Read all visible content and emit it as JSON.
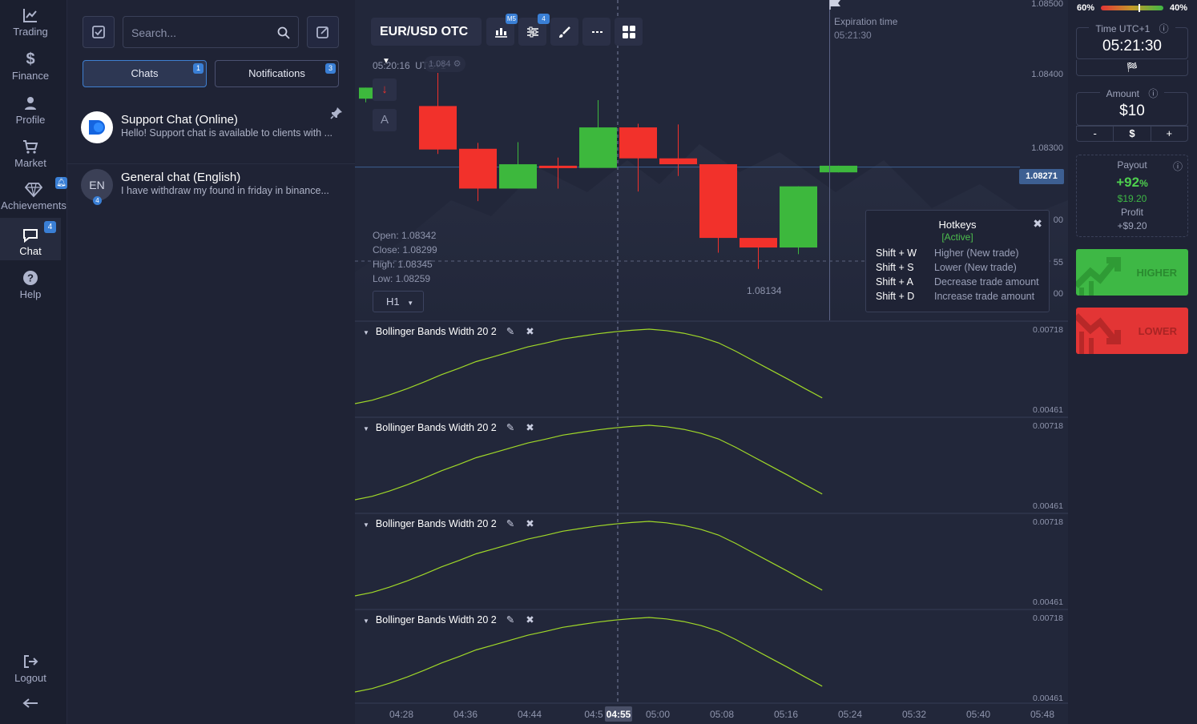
{
  "nav": {
    "items": [
      {
        "label": "Trading",
        "icon": "chart-line-icon"
      },
      {
        "label": "Finance",
        "icon": "dollar-icon"
      },
      {
        "label": "Profile",
        "icon": "user-icon"
      },
      {
        "label": "Market",
        "icon": "cart-icon"
      },
      {
        "label": "Achievements",
        "icon": "diamond-icon",
        "badge": "bell"
      },
      {
        "label": "Chat",
        "icon": "chat-icon",
        "badge": "4",
        "active": true
      },
      {
        "label": "Help",
        "icon": "help-icon"
      }
    ],
    "logout": "Logout",
    "collapse_icon": "arrow-left-icon"
  },
  "chat": {
    "search_placeholder": "Search...",
    "tabs": [
      {
        "label": "Chats",
        "badge": "1",
        "active": true
      },
      {
        "label": "Notifications",
        "badge": "3",
        "active": false
      }
    ],
    "items": [
      {
        "title": "Support Chat (Online)",
        "preview": "Hello! Support chat is available to clients with ...",
        "pinned": true,
        "avatar": "logo"
      },
      {
        "title": "General chat (English)",
        "preview": "I have withdraw my found in friday in binance...",
        "avatar_text": "EN",
        "avatar_badge": "4"
      }
    ]
  },
  "chart": {
    "pair": "EUR/USD OTC",
    "badges": {
      "chart_type": "M5",
      "indicators": "4"
    },
    "server_time": "05:20:16",
    "timezone": "UTC+1",
    "faded_price": "1.084",
    "trade_marker_down": "↓",
    "trade_marker_auto": "A",
    "expiration_label": "Expiration time",
    "expiration_time": "05:21:30",
    "ohlc": {
      "open": "Open: 1.08342",
      "close": "Close: 1.08299",
      "high": "High: 1.08345",
      "low": "Low: 1.08259"
    },
    "timeframe": "H1",
    "price_labels": [
      "1.08500",
      "1.08400",
      "1.08300",
      "00",
      "55",
      "00"
    ],
    "current_price": "1.08271",
    "low_marker": "1.08134",
    "time_labels": [
      "04:28",
      "04:36",
      "04:44",
      "04:5",
      "05:00",
      "05:08",
      "05:16",
      "05:24",
      "05:32",
      "05:40",
      "05:48"
    ],
    "cursor_time": "04:55",
    "indicator_title": "Bollinger Bands Width",
    "indicator_params": "20 2",
    "indicator_max": "0.00718",
    "indicator_min": "0.00461",
    "colors": {
      "up": "#3db83d",
      "down": "#f2312b",
      "line": "#a0d828",
      "bg": "#22273a"
    }
  },
  "chart_data": {
    "type": "candlestick",
    "candles": [
      {
        "open": 1.08365,
        "close": 1.0838,
        "high": 1.0838,
        "low": 1.0836
      },
      {
        "open": 1.08355,
        "close": 1.08296,
        "high": 1.084,
        "low": 1.0829
      },
      {
        "open": 1.08297,
        "close": 1.08243,
        "high": 1.08305,
        "low": 1.08226
      },
      {
        "open": 1.08243,
        "close": 1.08276,
        "high": 1.08306,
        "low": 1.08243
      },
      {
        "open": 1.08274,
        "close": 1.08272,
        "high": 1.08285,
        "low": 1.08243
      },
      {
        "open": 1.08271,
        "close": 1.08326,
        "high": 1.08363,
        "low": 1.08271
      },
      {
        "open": 1.08326,
        "close": 1.08284,
        "high": 1.08331,
        "low": 1.08239
      },
      {
        "open": 1.08284,
        "close": 1.08276,
        "high": 1.0833,
        "low": 1.0826
      },
      {
        "open": 1.08276,
        "close": 1.08176,
        "high": 1.08276,
        "low": 1.08156
      },
      {
        "open": 1.08176,
        "close": 1.08163,
        "high": 1.08176,
        "low": 1.08134
      },
      {
        "open": 1.08163,
        "close": 1.08246,
        "high": 1.08246,
        "low": 1.08154
      },
      {
        "open": 1.08265,
        "close": 1.08274,
        "high": 1.08274,
        "low": 1.08265
      }
    ],
    "indicator_values": [
      0.00461,
      0.00473,
      0.00491,
      0.00512,
      0.00536,
      0.00561,
      0.00583,
      0.00606,
      0.00623,
      0.0064,
      0.00657,
      0.0067,
      0.00684,
      0.00693,
      0.00702,
      0.00709,
      0.00714,
      0.00718,
      0.00713,
      0.00704,
      0.0069,
      0.00671,
      0.00642,
      0.0061,
      0.00578,
      0.00546,
      0.00513,
      0.00481
    ]
  },
  "right": {
    "sentiment_up": "60%",
    "sentiment_down": "40%",
    "sentiment_fraction": 0.6,
    "time_label": "Time UTC+1",
    "time_value": "05:21:30",
    "amount_label": "Amount",
    "amount_value": "$10",
    "amount_minus": "-",
    "amount_currency": "$",
    "amount_plus": "+",
    "payout_label": "Payout",
    "payout_pct": "+92",
    "payout_unit": "%",
    "payout_amount": "$19.20",
    "profit_label": "Profit",
    "profit_value": "+$9.20",
    "higher_label": "HIGHER",
    "lower_label": "LOWER",
    "higher_color": "#3eb845",
    "lower_color": "#e33535"
  },
  "hotkeys": {
    "title": "Hotkeys",
    "status": "[Active]",
    "rows": [
      {
        "key": "Shift + W",
        "action": "Higher (New trade)"
      },
      {
        "key": "Shift + S",
        "action": "Lower (New trade)"
      },
      {
        "key": "Shift + A",
        "action": "Decrease trade amount"
      },
      {
        "key": "Shift + D",
        "action": "Increase trade amount"
      }
    ]
  }
}
